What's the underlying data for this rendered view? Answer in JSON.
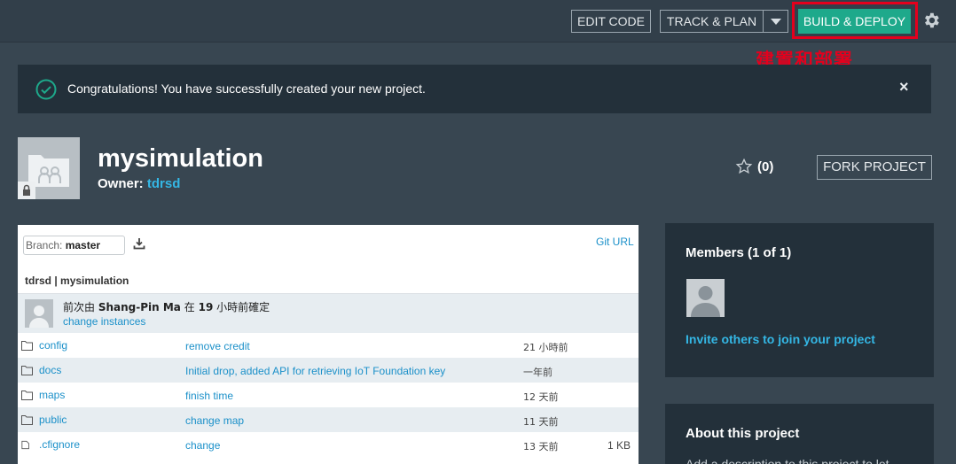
{
  "toolbar": {
    "edit_code": "EDIT CODE",
    "track_plan": "TRACK & PLAN",
    "build_deploy": "BUILD & DEPLOY",
    "icons": [
      "chevron-down-icon",
      "gear-icon"
    ]
  },
  "annotation": "建置和部署",
  "notice": {
    "message": "Congratulations! You have successfully created your new project.",
    "close": "×",
    "icon": "check-circle-icon"
  },
  "project": {
    "name": "mysimulation",
    "owner_label": "Owner:",
    "owner": "tdrsd",
    "star_count": "(0)",
    "fork": "FORK PROJECT"
  },
  "repo": {
    "branch_label": "Branch:",
    "branch": "master",
    "git_url": "Git URL",
    "path": "tdrsd | mysimulation",
    "commit": {
      "prefix": "前次由",
      "author": "Shang-Pin Ma",
      "middle": "在",
      "hours": "19",
      "suffix": "小時前確定",
      "link": "change instances"
    },
    "files": [
      {
        "name": "config",
        "message": "remove credit",
        "age": "21 小時前",
        "size": "",
        "type": "folder"
      },
      {
        "name": "docs",
        "message": "Initial drop, added API for retrieving IoT Foundation key",
        "age": "一年前",
        "size": "",
        "type": "folder"
      },
      {
        "name": "maps",
        "message": "finish time",
        "age": "12 天前",
        "size": "",
        "type": "folder"
      },
      {
        "name": "public",
        "message": "change map",
        "age": "11 天前",
        "size": "",
        "type": "folder"
      },
      {
        "name": ".cfignore",
        "message": "change",
        "age": "13 天前",
        "size": "1 KB",
        "type": "file"
      }
    ]
  },
  "members": {
    "title": "Members (1 of 1)",
    "invite": "Invite others to join your project"
  },
  "about": {
    "title": "About this project",
    "description": "Add a description to this project to let"
  },
  "colors": {
    "accent": "#1ea98b",
    "link": "#34b7e5",
    "highlight": "#e4001d",
    "background": "#384651"
  }
}
